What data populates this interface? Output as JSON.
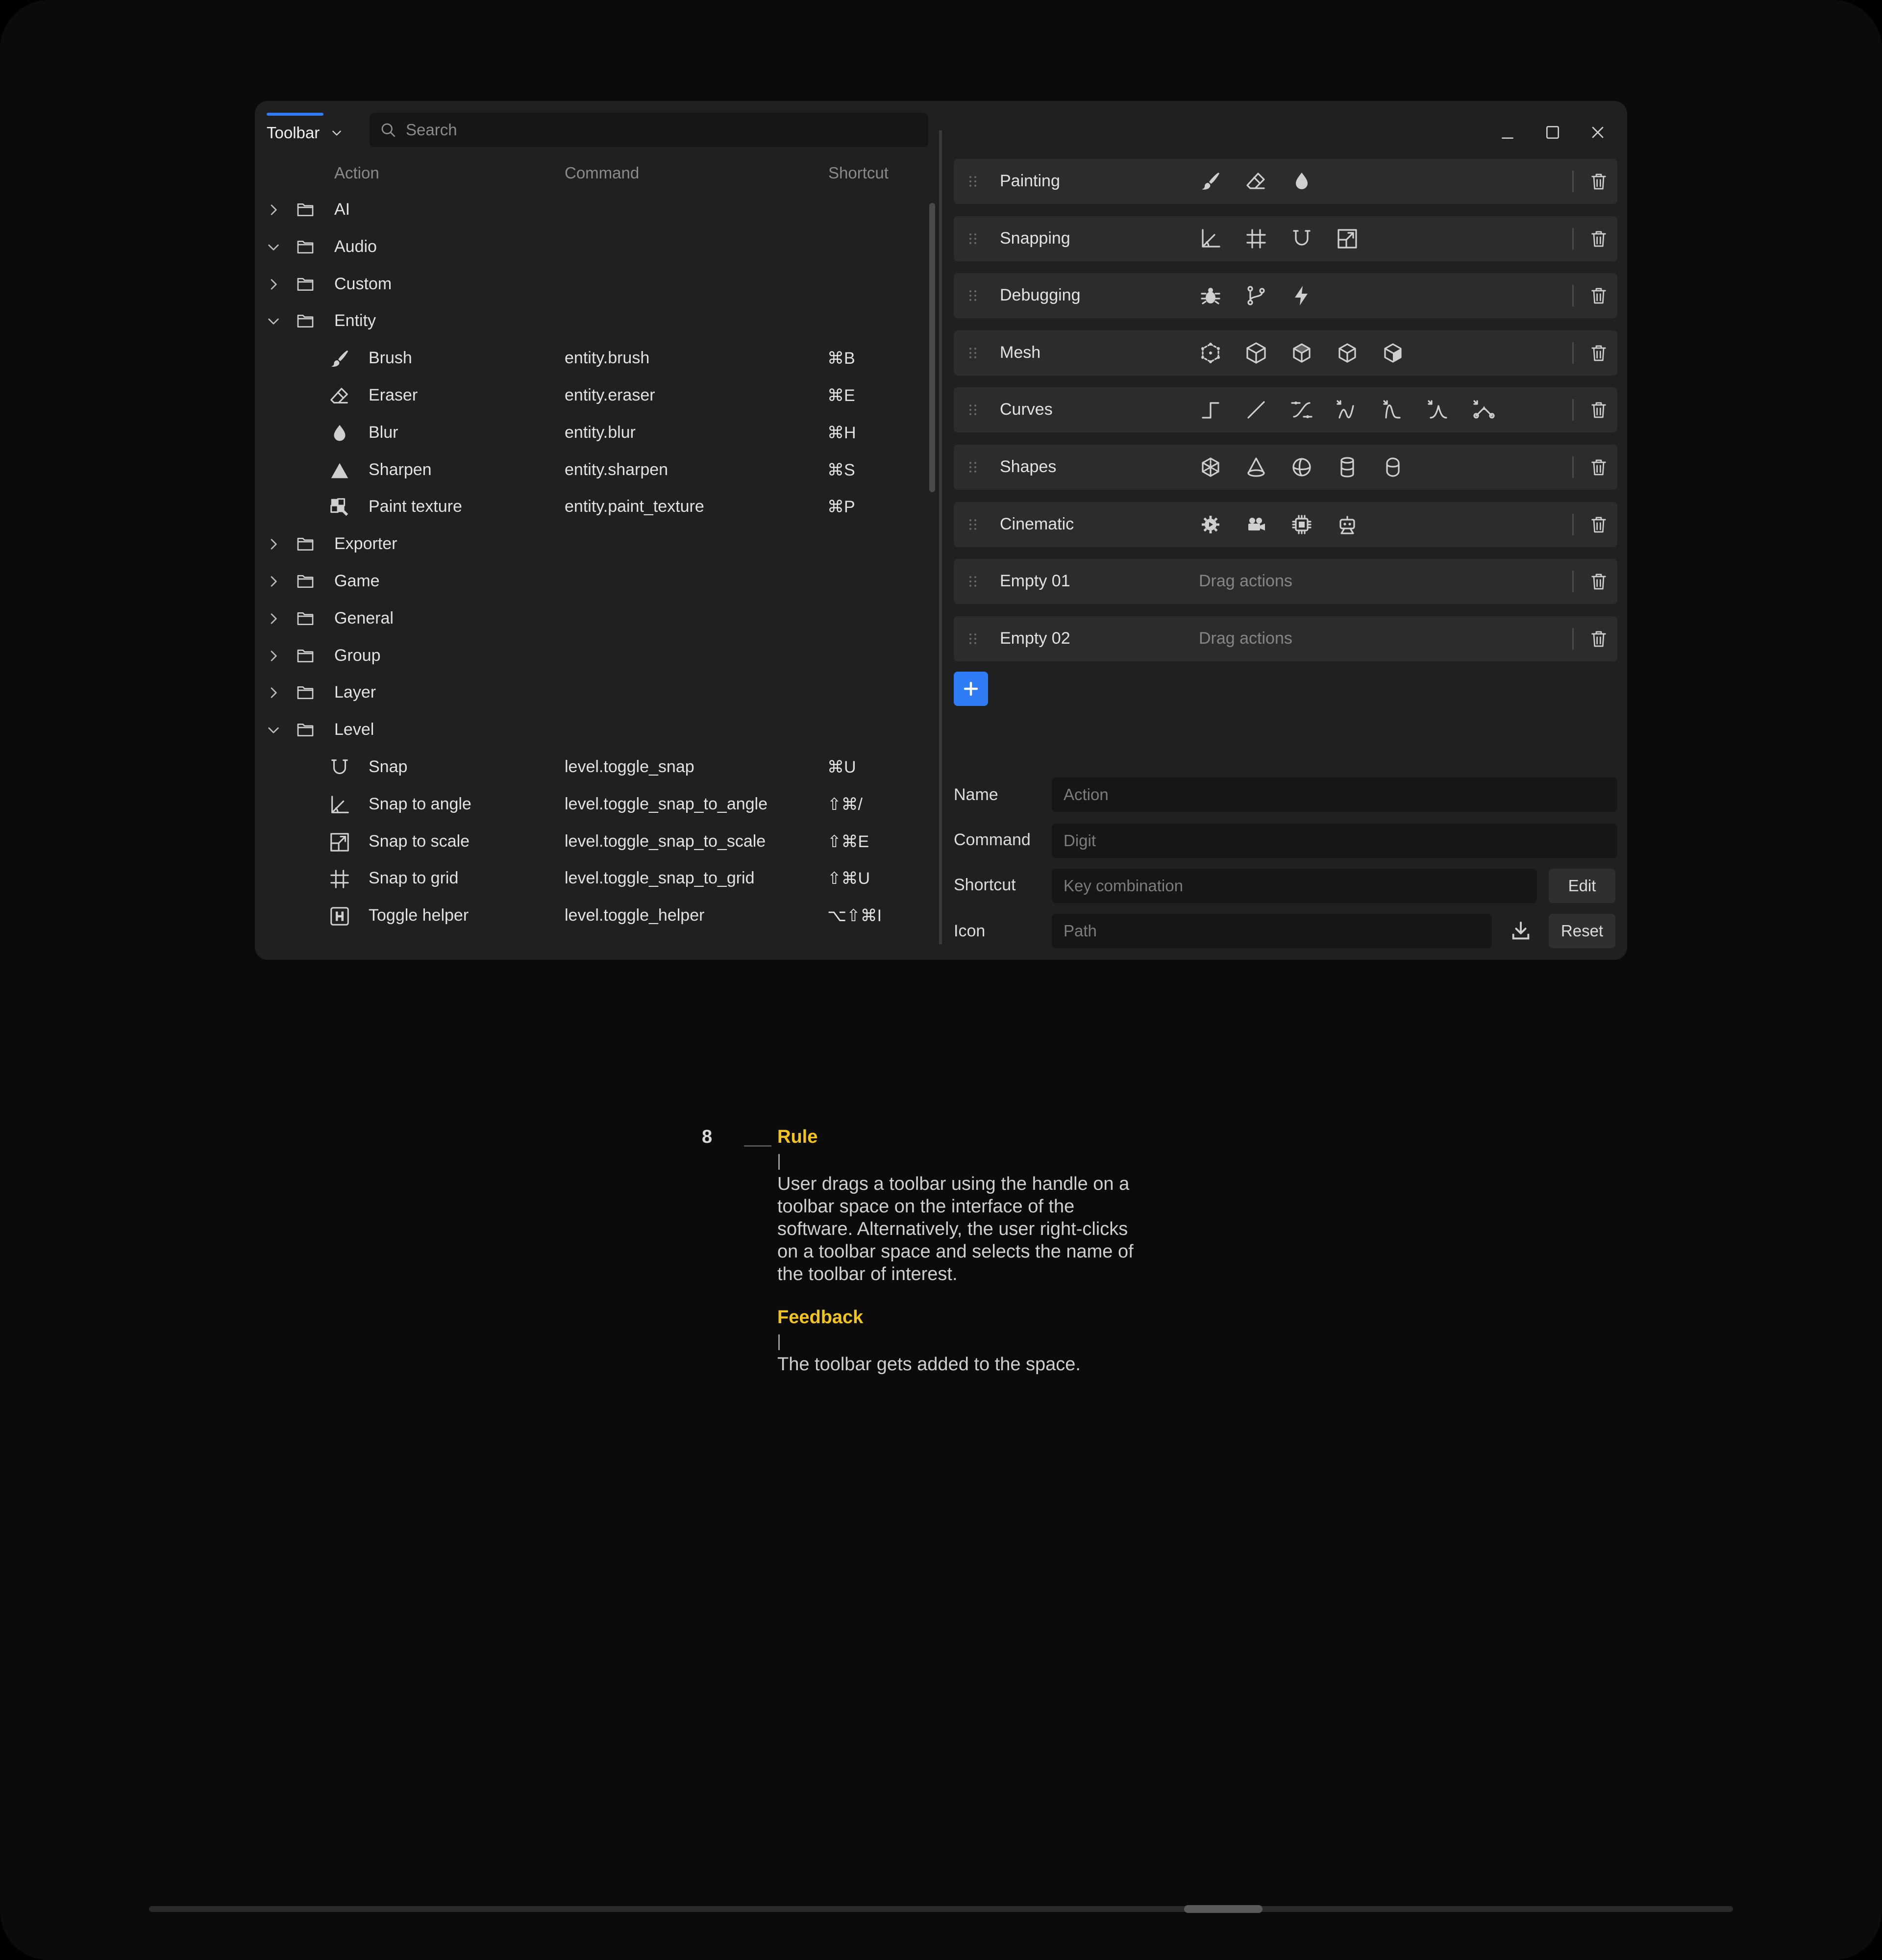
{
  "window": {
    "tab_label": "Toolbar",
    "search_placeholder": "Search",
    "columns": {
      "action": "Action",
      "command": "Command",
      "shortcut": "Shortcut"
    }
  },
  "tree": [
    {
      "type": "folder",
      "name": "AI",
      "expanded": false
    },
    {
      "type": "folder",
      "name": "Audio",
      "expanded": true
    },
    {
      "type": "folder",
      "name": "Custom",
      "expanded": false
    },
    {
      "type": "folder",
      "name": "Entity",
      "expanded": true
    },
    {
      "type": "action",
      "icon": "brush-icon",
      "name": "Brush",
      "command": "entity.brush",
      "shortcut": "⌘B"
    },
    {
      "type": "action",
      "icon": "eraser-icon",
      "name": "Eraser",
      "command": "entity.eraser",
      "shortcut": "⌘E"
    },
    {
      "type": "action",
      "icon": "blur-drop-icon",
      "name": "Blur",
      "command": "entity.blur",
      "shortcut": "⌘H"
    },
    {
      "type": "action",
      "icon": "sharpen-triangle-icon",
      "name": "Sharpen",
      "command": "entity.sharpen",
      "shortcut": "⌘S"
    },
    {
      "type": "action",
      "icon": "paint-texture-icon",
      "name": "Paint texture",
      "command": "entity.paint_texture",
      "shortcut": "⌘P"
    },
    {
      "type": "folder",
      "name": "Exporter",
      "expanded": false
    },
    {
      "type": "folder",
      "name": "Game",
      "expanded": false
    },
    {
      "type": "folder",
      "name": "General",
      "expanded": false
    },
    {
      "type": "folder",
      "name": "Group",
      "expanded": false
    },
    {
      "type": "folder",
      "name": "Layer",
      "expanded": false
    },
    {
      "type": "folder",
      "name": "Level",
      "expanded": true
    },
    {
      "type": "action",
      "icon": "magnet-icon",
      "name": "Snap",
      "command": "level.toggle_snap",
      "shortcut": "⌘U"
    },
    {
      "type": "action",
      "icon": "angle-icon",
      "name": "Snap to angle",
      "command": "level.toggle_snap_to_angle",
      "shortcut": "⇧⌘/"
    },
    {
      "type": "action",
      "icon": "scale-icon",
      "name": "Snap to scale",
      "command": "level.toggle_snap_to_scale",
      "shortcut": "⇧⌘E"
    },
    {
      "type": "action",
      "icon": "grid-icon",
      "name": "Snap to grid",
      "command": "level.toggle_snap_to_grid",
      "shortcut": "⇧⌘U"
    },
    {
      "type": "action",
      "icon": "helper-h-icon",
      "name": "Toggle helper",
      "command": "level.toggle_helper",
      "shortcut": "⌥⇧⌘I"
    }
  ],
  "toolbars": [
    {
      "name": "Painting",
      "icons": [
        "brush-icon",
        "eraser-icon",
        "blur-drop-icon"
      ]
    },
    {
      "name": "Snapping",
      "icons": [
        "angle-icon",
        "grid-icon",
        "magnet-icon",
        "scale-icon"
      ]
    },
    {
      "name": "Debugging",
      "icons": [
        "bug-icon",
        "branch-icon",
        "lightning-icon"
      ]
    },
    {
      "name": "Mesh",
      "icons": [
        "mesh-vertices-icon",
        "mesh-edges-icon",
        "mesh-faces-icon",
        "mesh-object-icon",
        "mesh-solid-icon"
      ]
    },
    {
      "name": "Curves",
      "icons": [
        "curve-step-icon",
        "curve-linear-icon",
        "curve-bezier-icon",
        "curve-wave-icon",
        "curve-peak-icon",
        "curve-sharp-icon",
        "curve-nodes-icon"
      ]
    },
    {
      "name": "Shapes",
      "icons": [
        "cube-icon",
        "cone-icon",
        "sphere-icon",
        "cylinder-icon",
        "capsule-icon"
      ]
    },
    {
      "name": "Cinematic",
      "icons": [
        "camera-gear-icon",
        "movie-camera-icon",
        "chip-icon",
        "robot-icon"
      ]
    },
    {
      "name": "Empty 01",
      "placeholder": "Drag actions"
    },
    {
      "name": "Empty 02",
      "placeholder": "Drag actions"
    }
  ],
  "form": {
    "name_label": "Name",
    "name_placeholder": "Action",
    "command_label": "Command",
    "command_placeholder": "Digit",
    "shortcut_label": "Shortcut",
    "shortcut_placeholder": "Key combination",
    "edit_label": "Edit",
    "icon_label": "Icon",
    "icon_placeholder": "Path",
    "reset_label": "Reset"
  },
  "doc": {
    "step_number": "8",
    "rule_heading": "Rule",
    "rule_lines": [
      "User drags a toolbar using the handle on a",
      "toolbar space on the interface of the",
      "software. Alternatively, the user right-clicks",
      "on a toolbar space and selects the name of",
      "the toolbar of interest."
    ],
    "feedback_heading": "Feedback",
    "feedback_text": "The toolbar gets added to the space."
  },
  "colors": {
    "accent": "#2f7cf6",
    "heading": "#f2c318",
    "window_bg": "#202020",
    "page_bg": "#0b0b0b"
  }
}
